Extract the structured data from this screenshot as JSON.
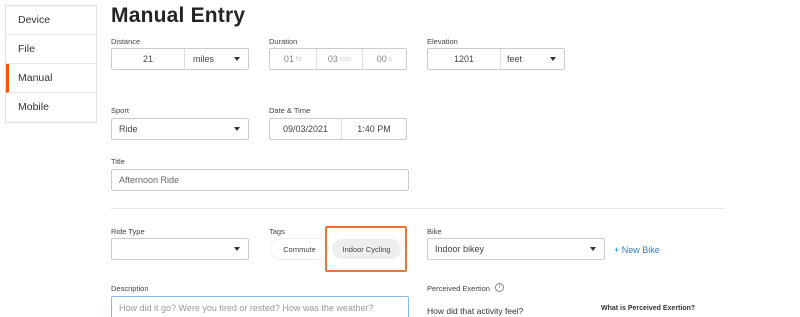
{
  "sidebar": {
    "items": [
      "Device",
      "File",
      "Manual",
      "Mobile"
    ]
  },
  "page_title": "Manual Entry",
  "distance": {
    "label": "Distance",
    "value": "21",
    "unit": "miles"
  },
  "duration": {
    "label": "Duration",
    "hours": "01",
    "hours_unit": "hr",
    "minutes": "03",
    "minutes_unit": "min",
    "seconds": "00",
    "seconds_unit": "s"
  },
  "elevation": {
    "label": "Elevation",
    "value": "1201",
    "unit": "feet"
  },
  "sport": {
    "label": "Sport",
    "value": "Ride"
  },
  "datetime": {
    "label": "Date & Time",
    "date": "09/03/2021",
    "time": "1:40 PM"
  },
  "title_field": {
    "label": "Title",
    "value": "Afternoon Ride"
  },
  "ride_type": {
    "label": "Ride Type",
    "value": ""
  },
  "tags": {
    "label": "Tags",
    "items": [
      "Commute",
      "Indoor Cycling"
    ]
  },
  "bike": {
    "label": "Bike",
    "value": "Indoor bikey",
    "new_bike_link": "+ New Bike"
  },
  "description": {
    "label": "Description",
    "placeholder": "How did it go? Were you tired or rested? How was the weather?"
  },
  "perceived_exertion": {
    "label": "Perceived Exertion",
    "info_icon": "i",
    "question": "How did that activity feel?",
    "what_is_link": "What is Perceived Exertion?"
  },
  "colors": {
    "accent": "#fc5200",
    "highlight_outline": "#f0742d",
    "link": "#2a7fc1"
  }
}
